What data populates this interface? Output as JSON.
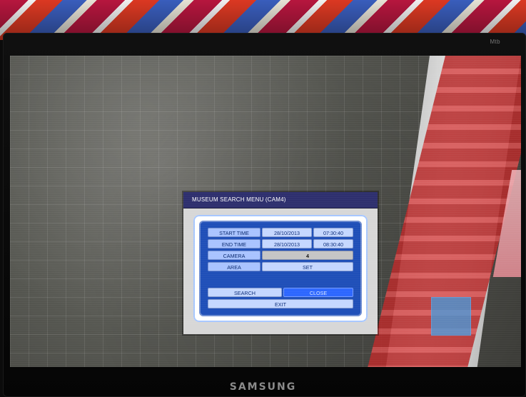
{
  "photo": {
    "monitor_brand": "SAMSUNG",
    "monitor_model_mark": "Mtb"
  },
  "osd": {
    "title": "MUSEUM SEARCH MENU (CAM4)",
    "fields": {
      "start_time": {
        "label": "START TIME",
        "date": "28/10/2013",
        "time": "07:30:40"
      },
      "end_time": {
        "label": "END TIME",
        "date": "28/10/2013",
        "time": "08:30:40"
      },
      "camera": {
        "label": "CAMERA",
        "value": "4"
      },
      "area": {
        "label": "AREA",
        "value": "SET"
      }
    },
    "buttons": {
      "search": "SEARCH",
      "close": "CLOSE",
      "exit": "EXIT"
    }
  }
}
